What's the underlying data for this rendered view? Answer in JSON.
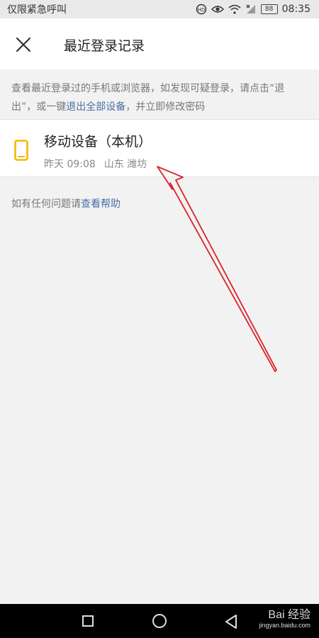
{
  "status_bar": {
    "carrier": "仅限紧急呼叫",
    "battery": "88",
    "time": "08:35"
  },
  "header": {
    "title": "最近登录记录"
  },
  "notice": {
    "text_before": "查看最近登录过的手机或浏览器，如发现可疑登录，请点击“退出”，或一键",
    "link": "退出全部设备",
    "text_after": "，并立即修改密码"
  },
  "device": {
    "name": "移动设备（本机）",
    "time": "昨天 09:08",
    "location": "山东 潍坊",
    "icon_color": "#f5b800"
  },
  "help": {
    "text": "如有任何问题请",
    "link": "查看帮助"
  },
  "watermark": {
    "brand": "Bai 经验",
    "url": "jingyan.baidu.com"
  },
  "colors": {
    "link": "#4a6fa5",
    "arrow": "#d9232a",
    "background": "#f2f2f2"
  }
}
